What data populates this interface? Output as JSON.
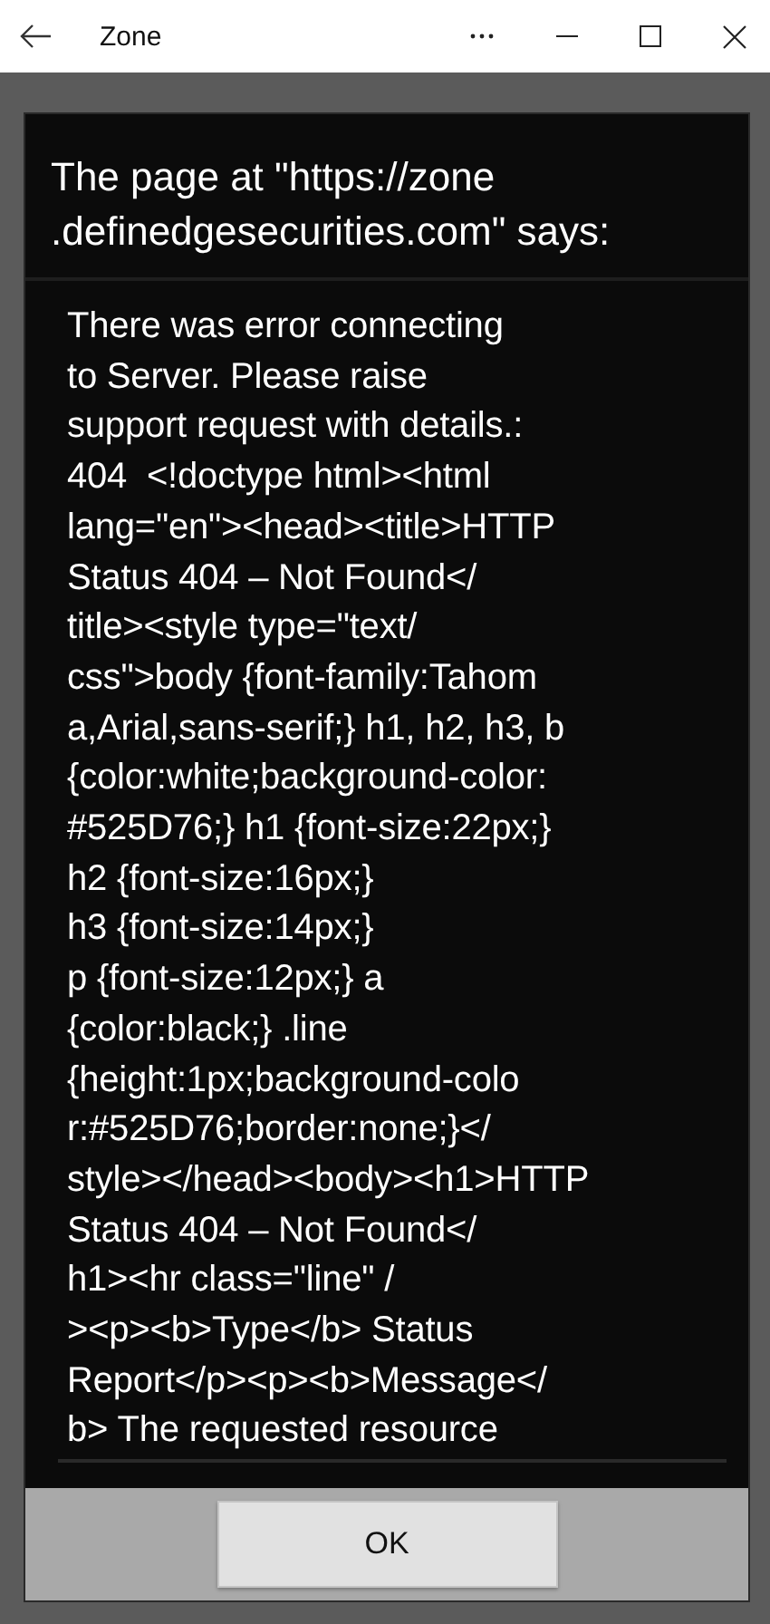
{
  "window": {
    "title": "Zone"
  },
  "dialog": {
    "title": "The page at \"https://zone\n.definedgesecurities.com\" says:",
    "message": "There was error connecting\nto Server. Please raise\nsupport request with details.:\n404  <!doctype html><html\nlang=\"en\"><head><title>HTTP\nStatus 404 – Not Found</\ntitle><style type=\"text/\ncss\">body {font-family:Tahom\na,Arial,sans-serif;} h1, h2, h3, b\n{color:white;background-color:\n#525D76;} h1 {font-size:22px;}\nh2 {font-size:16px;}\nh3 {font-size:14px;}\np {font-size:12px;} a\n{color:black;} .line\n{height:1px;background-colo\nr:#525D76;border:none;}</\nstyle></head><body><h1>HTTP\nStatus 404 – Not Found</\nh1><hr class=\"line\" /\n><p><b>Type</b> Status\nReport</p><p><b>Message</\nb> The requested resource",
    "buttons": [
      "OK"
    ]
  }
}
